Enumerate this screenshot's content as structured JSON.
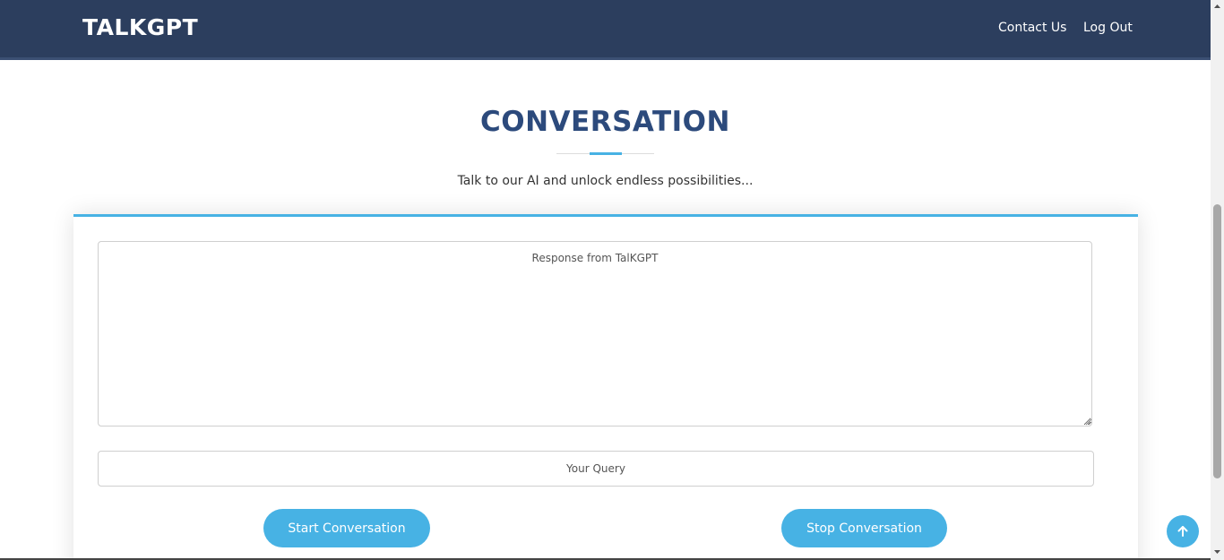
{
  "header": {
    "logo": "TALKGPT",
    "nav": {
      "contact_label": "Contact Us",
      "logout_label": "Log Out"
    }
  },
  "section": {
    "title": "CONVERSATION",
    "subtitle": "Talk to our AI and unlock endless possibilities..."
  },
  "form": {
    "response_placeholder": "Response from TalKGPT",
    "query_placeholder": "Your Query",
    "start_label": "Start Conversation",
    "stop_label": "Stop Conversation"
  },
  "icons": {
    "back_to_top": "arrow-up-icon"
  },
  "colors": {
    "navbar": "#2c3e5e",
    "accent": "#47b2e4",
    "title": "#2c4a7c"
  }
}
